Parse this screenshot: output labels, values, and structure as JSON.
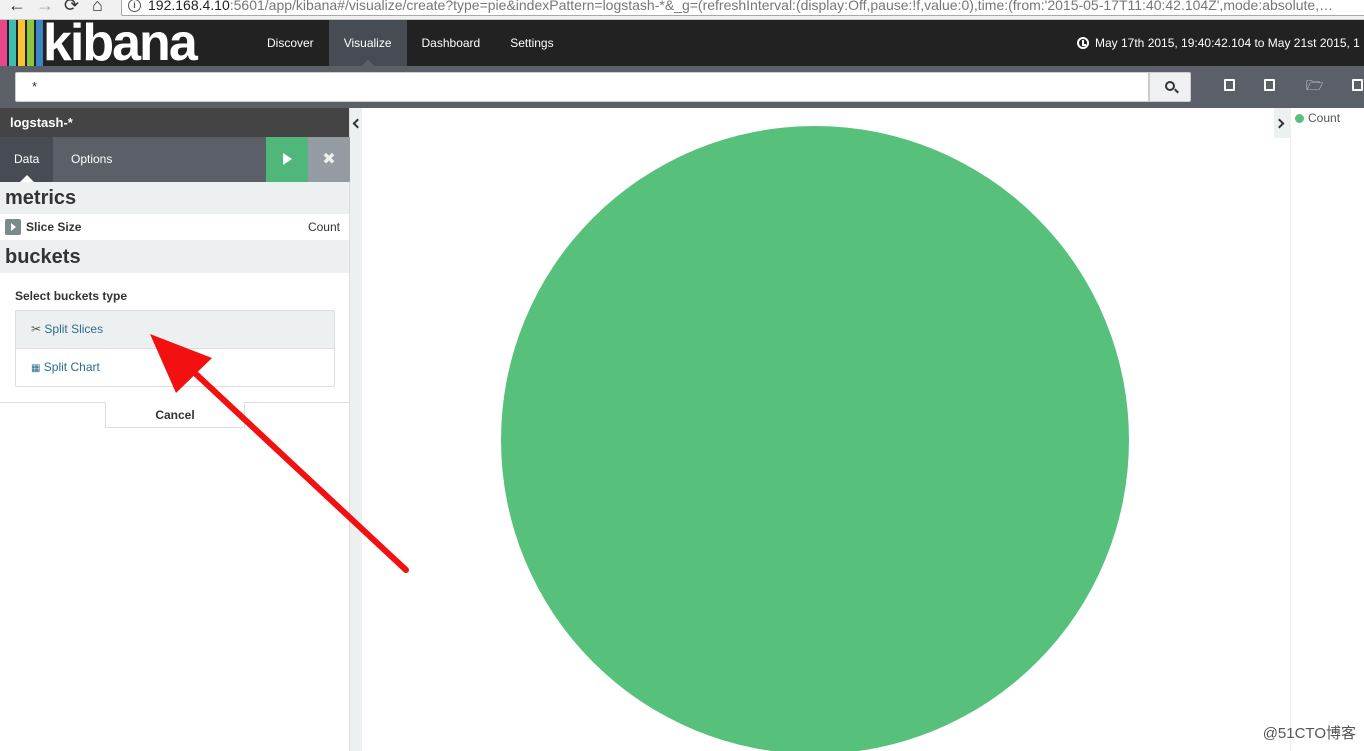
{
  "browser": {
    "url_host": "192.168.4.10",
    "url_rest": ":5601/app/kibana#/visualize/create?type=pie&indexPattern=logstash-*&_g=(refreshInterval:(display:Off,pause:!f,value:0),time:(from:'2015-05-17T11:40:42.104Z',mode:absolute,…",
    "back": "←",
    "forward": "→",
    "reload": "⟳",
    "home": "⌂"
  },
  "brand": {
    "name": "kibana",
    "bar_colors": [
      "#e8488b",
      "#3ebeb0",
      "#f9c333",
      "#8cc63f",
      "#3a86c7"
    ]
  },
  "nav": {
    "links": [
      "Discover",
      "Visualize",
      "Dashboard",
      "Settings"
    ],
    "active": "Visualize"
  },
  "time": {
    "range": "May 17th 2015, 19:40:42.104 to May 21st 2015, 1"
  },
  "query": {
    "value": "*"
  },
  "sidebar": {
    "index_pattern": "logstash-*",
    "tabs": [
      "Data",
      "Options"
    ],
    "metrics": {
      "heading": "metrics",
      "items": [
        {
          "label": "Slice Size",
          "value": "Count"
        }
      ]
    },
    "buckets": {
      "heading": "buckets",
      "select_label": "Select buckets type",
      "options": [
        {
          "label": "Split Slices",
          "icon": "scissors-icon"
        },
        {
          "label": "Split Chart",
          "icon": "grid-icon"
        }
      ],
      "cancel": "Cancel"
    }
  },
  "chart_data": {
    "type": "pie",
    "categories": [
      "Count"
    ],
    "values": [
      100
    ],
    "colors": [
      "#57c17b"
    ],
    "legend": "right"
  },
  "watermark": "@51CTO博客"
}
